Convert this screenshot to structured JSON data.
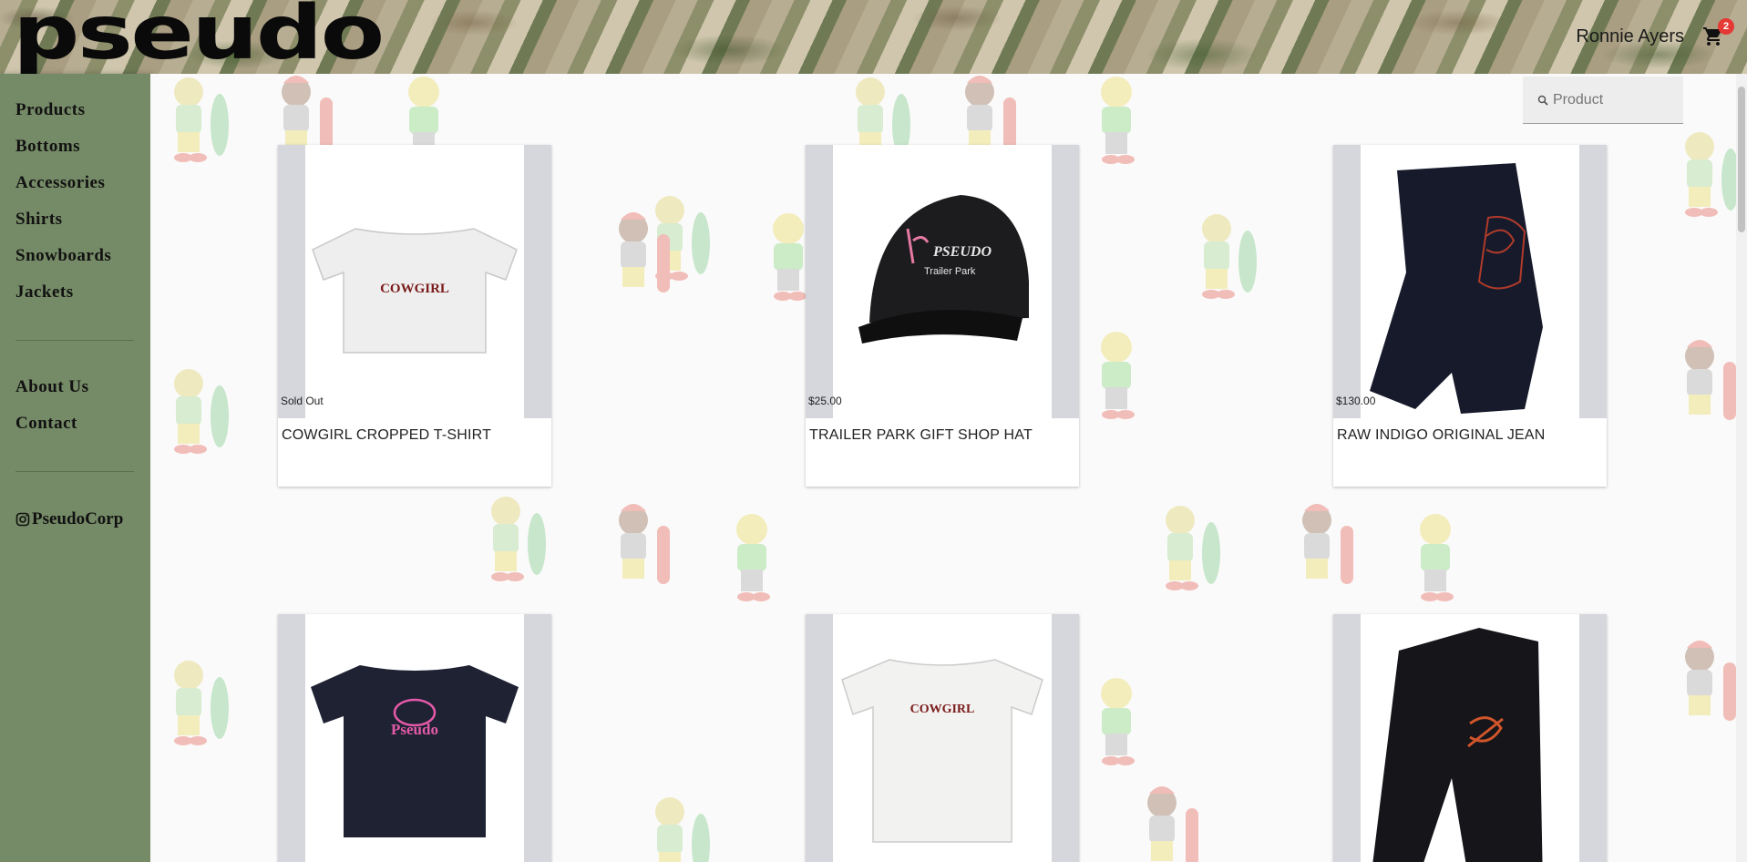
{
  "header": {
    "logo": "pseudo",
    "user_name": "Ronnie Ayers",
    "cart_icon": "shopping-cart-icon",
    "cart_count": "2"
  },
  "sidebar": {
    "nav": [
      "Products",
      "Bottoms",
      "Accessories",
      "Shirts",
      "Snowboards",
      "Jackets"
    ],
    "secondary": [
      "About Us",
      "Contact"
    ],
    "social": {
      "icon": "instagram-icon",
      "handle": "PseudoCorp"
    }
  },
  "search": {
    "placeholder": "Product",
    "icon": "search-icon"
  },
  "products": [
    {
      "title": "COWGIRL CROPPED T-SHIRT",
      "price": "Sold Out",
      "image": "white cropped t-shirt with COWGIRL print"
    },
    {
      "title": "TRAILER PARK GIFT SHOP HAT",
      "price": "$25.00",
      "image": "black cap with Pseudo Trailer Park flamingo logo"
    },
    {
      "title": "RAW INDIGO ORIGINAL JEAN",
      "price": "$130.00",
      "image": "raw indigo jeans with red pocket stitch"
    },
    {
      "title": "",
      "price": "",
      "image": "navy t-shirt with pink Pseudo logo"
    },
    {
      "title": "",
      "price": "",
      "image": "white t-shirt with COWGIRL print"
    },
    {
      "title": "",
      "price": "",
      "image": "black jeans with orange pocket stitch"
    }
  ],
  "colors": {
    "sidebar": "#758a66",
    "badge": "#e53935",
    "text": "#222222"
  }
}
